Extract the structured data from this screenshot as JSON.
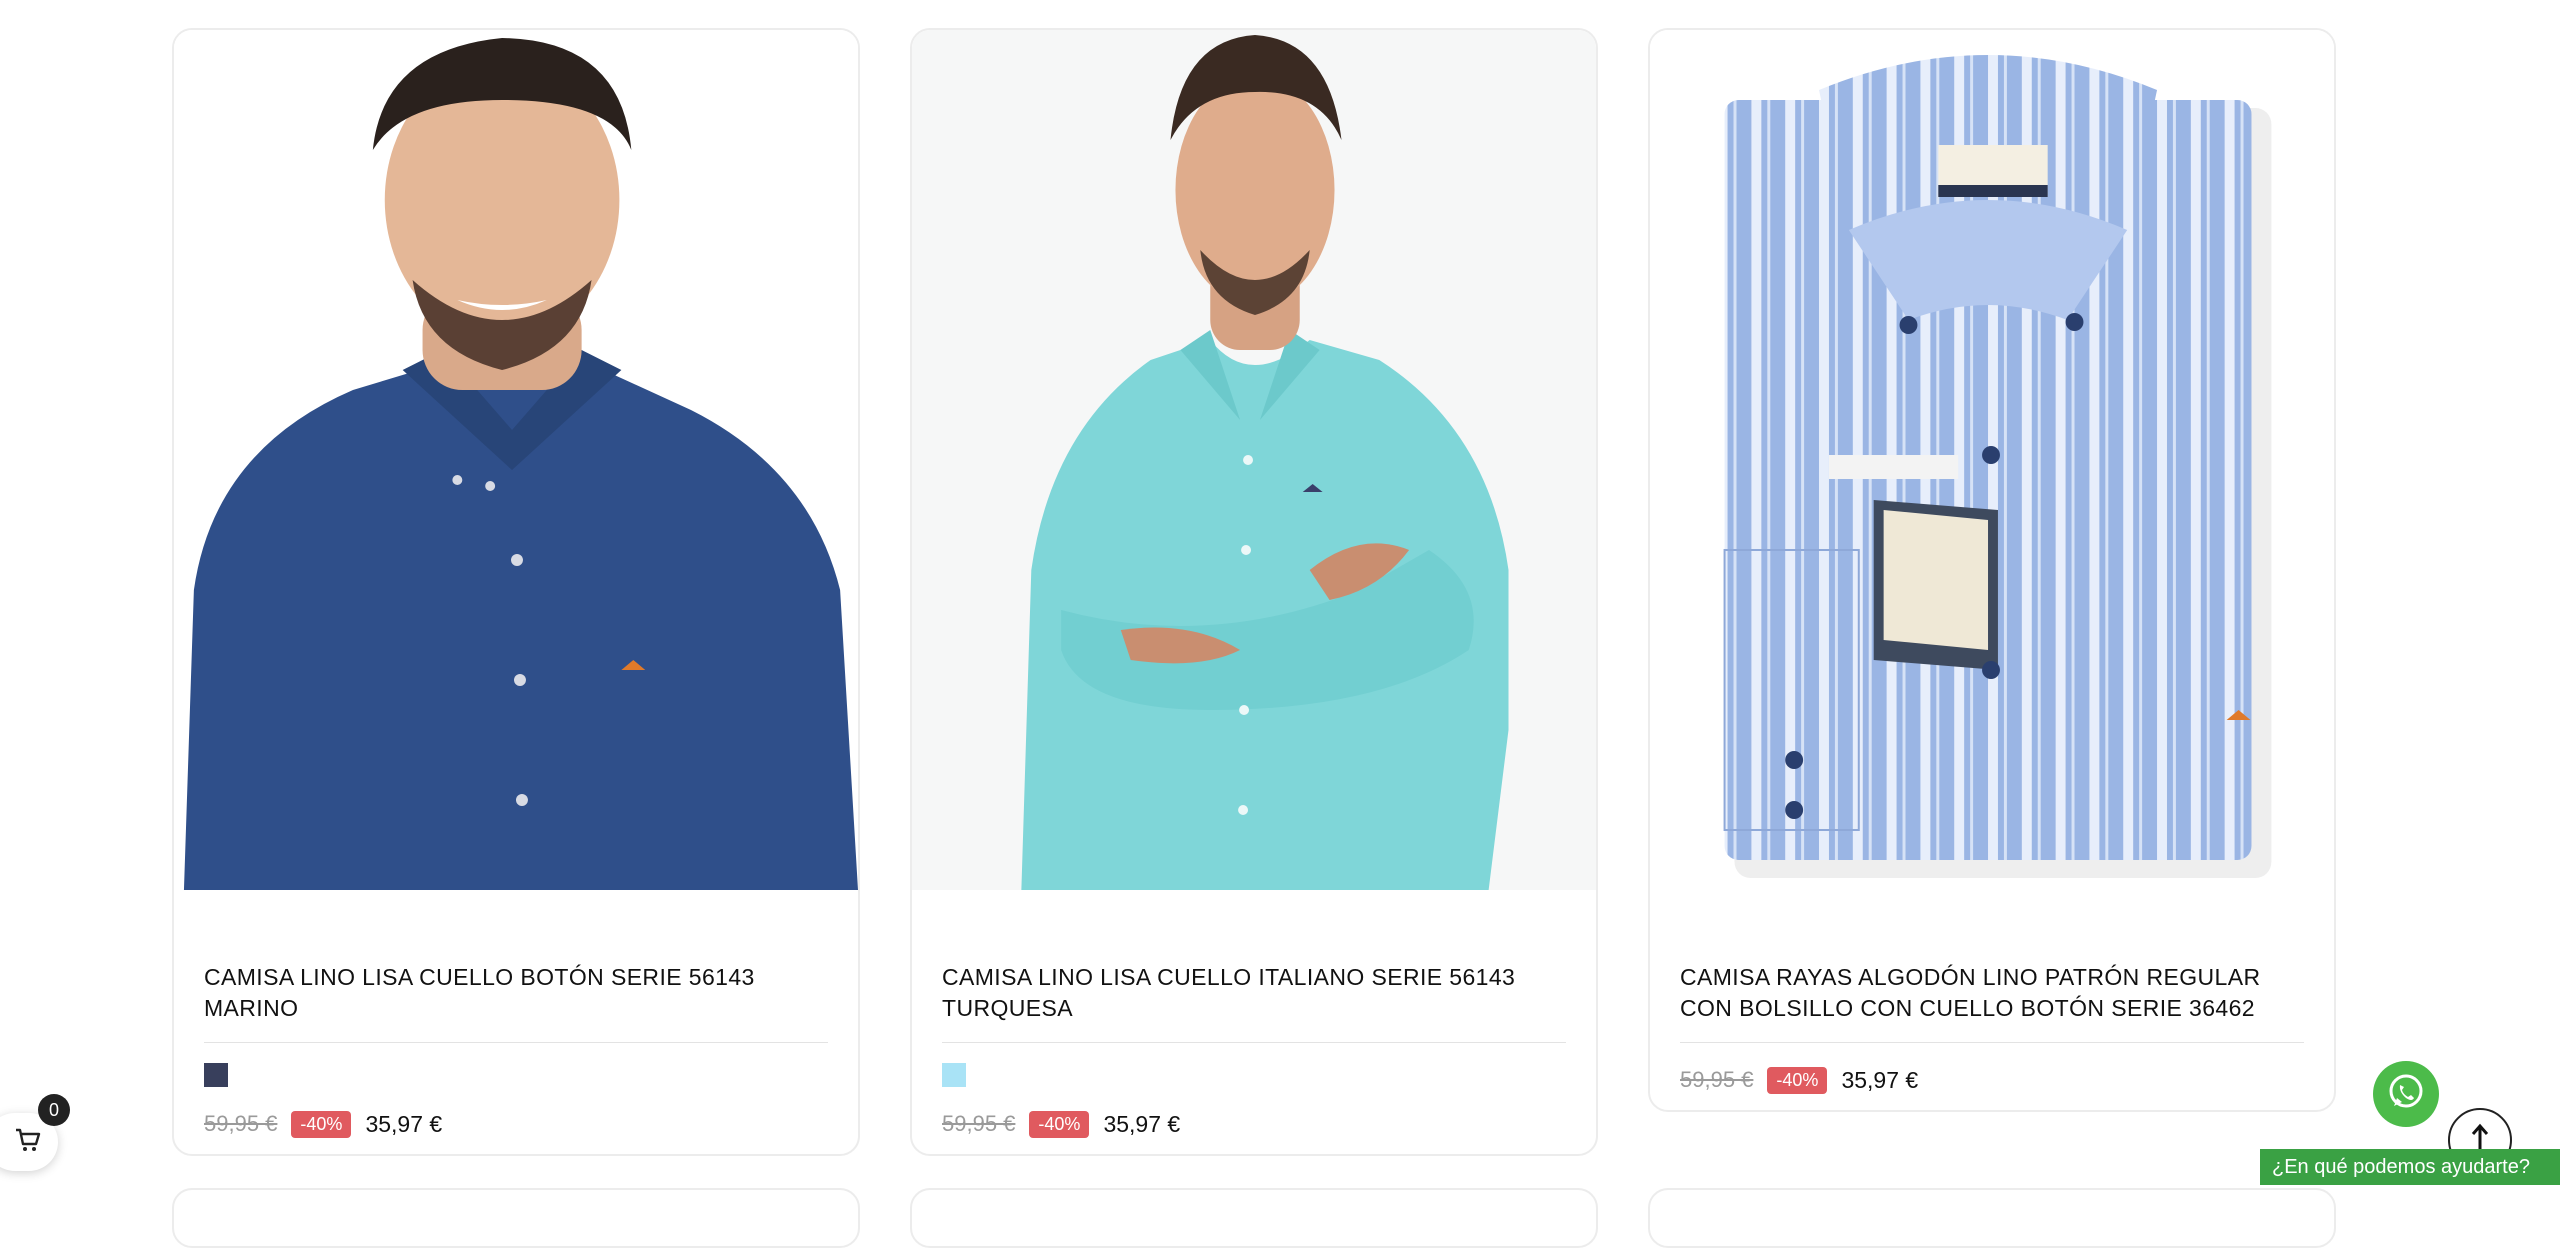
{
  "products": [
    {
      "name": "CAMISA LINO LISA CUELLO BOTÓN SERIE 56143 MARINO",
      "image_alt": "model-navy-shirt",
      "swatch_color": "#383f5c",
      "old_price": "59,95 €",
      "discount": "-40%",
      "price": "35,97 €"
    },
    {
      "name": "CAMISA LINO LISA CUELLO ITALIANO SERIE 56143 TURQUESA",
      "image_alt": "model-turquoise-shirt",
      "swatch_color": "#a9e3f6",
      "old_price": "59,95 €",
      "discount": "-40%",
      "price": "35,97 €"
    },
    {
      "name": "CAMISA RAYAS ALGODÓN LINO PATRÓN REGULAR CON BOLSILLO CON CUELLO BOTÓN SERIE 36462",
      "image_alt": "folded-striped-shirt",
      "old_price": "59,95 €",
      "discount": "-40%",
      "price": "35,97 €"
    }
  ],
  "cart": {
    "icon": "cart-icon",
    "count": "0"
  },
  "whatsapp": {
    "icon": "whatsapp-icon",
    "tooltip": "¿En qué podemos ayudarte?"
  },
  "scroll_top": {
    "icon": "arrow-up-icon"
  },
  "colors": {
    "discount_badge": "#e05a5f",
    "whatsapp_green": "#4cbb4a",
    "help_tag_green": "#3aa144"
  }
}
